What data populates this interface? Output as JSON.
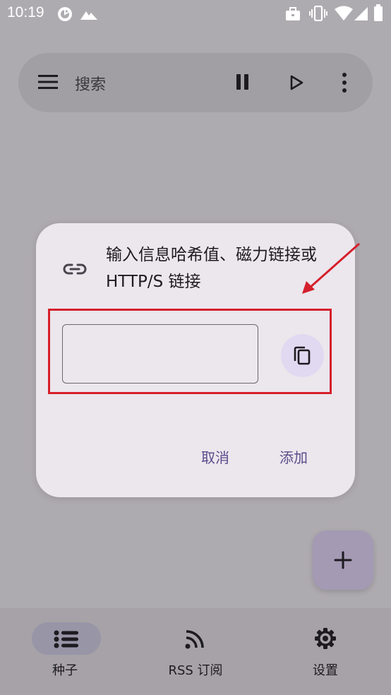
{
  "status_bar": {
    "time": "10:19",
    "icons": [
      "data-saver-icon",
      "mountain-icon",
      "briefcase-icon",
      "vibrate-icon",
      "wifi-icon",
      "signal-icon",
      "battery-icon"
    ]
  },
  "search_bar": {
    "placeholder": "搜索",
    "icons": [
      "menu-icon",
      "pause-icon",
      "play-icon",
      "more-vert-icon"
    ]
  },
  "dialog": {
    "title": "输入信息哈希值、磁力链接或 HTTP/S 链接",
    "icon": "link-icon",
    "input_value": "",
    "paste_icon": "content-copy-icon",
    "cancel_label": "取消",
    "add_label": "添加",
    "highlight_color": "#d51f2b"
  },
  "fab": {
    "icon": "plus-icon"
  },
  "bottom_nav": {
    "items": [
      {
        "label": "种子",
        "icon": "list-icon",
        "selected": true
      },
      {
        "label": "RSS 订阅",
        "icon": "rss-icon",
        "selected": false
      },
      {
        "label": "设置",
        "icon": "gear-icon",
        "selected": false
      }
    ]
  },
  "colors": {
    "accent": "#5b4b8a",
    "dialog_bg": "#ece6ed",
    "scrim": "#aeabb0"
  }
}
